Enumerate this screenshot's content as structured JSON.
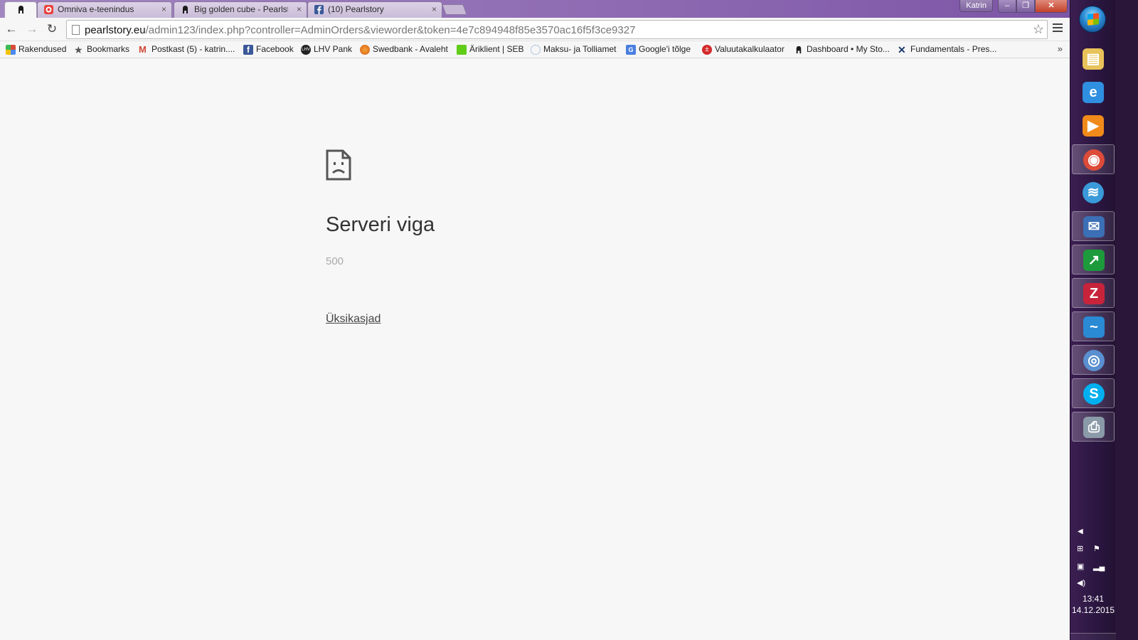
{
  "browser": {
    "profile_name": "Katrin",
    "tabs": [
      {
        "title": "",
        "favicon": "pearlstory-icon",
        "active": true
      },
      {
        "title": "Omniva e-teenindus",
        "favicon": "omniva-icon",
        "active": false,
        "close": "×"
      },
      {
        "title": "Big golden cube - Pearlstory",
        "favicon": "pearlstory-icon",
        "active": false,
        "close": "×"
      },
      {
        "title": "(10) Pearlstory",
        "favicon": "facebook-icon",
        "active": false,
        "close": "×"
      }
    ],
    "nav": {
      "back": "←",
      "forward": "→",
      "reload": "↻",
      "star": "☆"
    },
    "url": {
      "host": "pearlstory.eu",
      "path": "/admin123/index.php?controller=AdminOrders&vieworder&token=4e7c894948f85e3570ac16f5f3ce9327"
    },
    "bookmarks": [
      {
        "label": "Rakendused",
        "icon": "apps-grid-icon",
        "color": "#d94a38"
      },
      {
        "label": "Bookmarks",
        "icon": "star-icon",
        "color": "#555555"
      },
      {
        "label": "Postkast (5) - katrin....",
        "icon": "gmail-icon",
        "color": "#d14836"
      },
      {
        "label": "Facebook",
        "icon": "facebook-icon",
        "color": "#3b5998"
      },
      {
        "label": "LHV Pank",
        "icon": "lhv-icon",
        "color": "#222222"
      },
      {
        "label": "Swedbank - Avaleht",
        "icon": "swedbank-icon",
        "color": "#ee7023"
      },
      {
        "label": "Äriklient | SEB",
        "icon": "seb-icon",
        "color": "#60cd18"
      },
      {
        "label": "Maksu- ja Tolliamet",
        "icon": "emta-icon",
        "color": "#6a8fcf"
      },
      {
        "label": "Google'i tõlge",
        "icon": "google-translate-icon",
        "color": "#4a7fe0"
      },
      {
        "label": "Valuutakalkulaator",
        "icon": "currency-icon",
        "color": "#d42a2a"
      },
      {
        "label": "Dashboard • My Sto...",
        "icon": "pearlstory-icon",
        "color": "#222222"
      },
      {
        "label": "Fundamentals - Pres...",
        "icon": "prestashop-icon",
        "color": "#1a3a6a"
      }
    ],
    "bookmarks_more": "»"
  },
  "error_page": {
    "title": "Serveri viga",
    "code": "500",
    "details_link": "Üksikasjad"
  },
  "taskbar": {
    "apps": [
      {
        "name": "file-explorer-icon",
        "color": "#e8c25a",
        "running": false
      },
      {
        "name": "internet-explorer-icon",
        "color": "#2f8fe0",
        "running": false
      },
      {
        "name": "media-player-icon",
        "color": "#f08a1a",
        "running": false
      },
      {
        "name": "chrome-icon",
        "color": "#dd4b39",
        "running": true
      },
      {
        "name": "network-icon",
        "color": "#3a9ad9",
        "running": false
      },
      {
        "name": "thunderbird-icon",
        "color": "#3b6fb6",
        "running": true
      },
      {
        "name": "stock-chart-icon",
        "color": "#1d9a3c",
        "running": true
      },
      {
        "name": "filezilla-icon",
        "color": "#c7233b",
        "running": true
      },
      {
        "name": "remote-app-icon",
        "color": "#2a8ad3",
        "running": true
      },
      {
        "name": "chromium-icon",
        "color": "#5a8fd0",
        "running": true
      },
      {
        "name": "skype-icon",
        "color": "#00aff0",
        "running": true
      },
      {
        "name": "printer-icon",
        "color": "#8a9aa8",
        "running": true
      }
    ],
    "clock": {
      "time": "13:41",
      "date": "14.12.2015"
    }
  }
}
